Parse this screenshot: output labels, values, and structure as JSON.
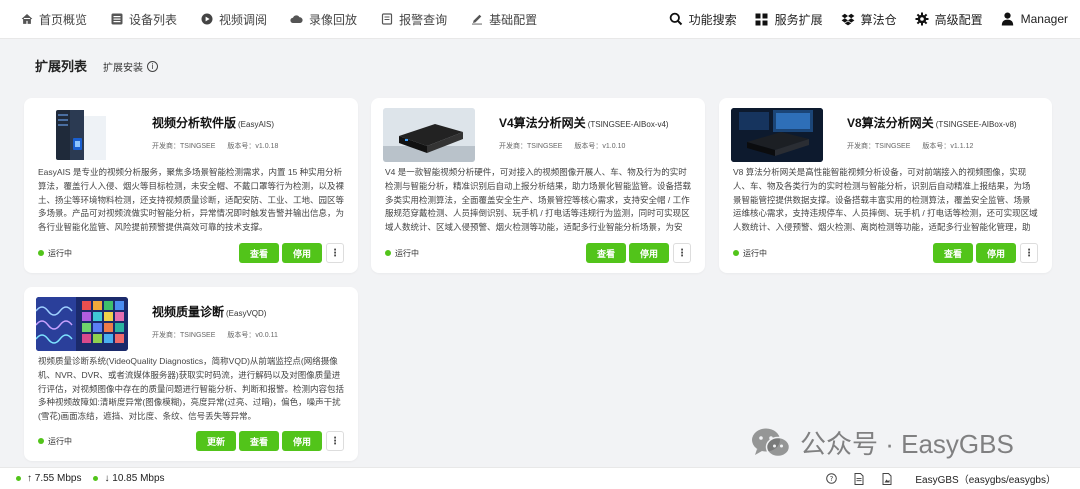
{
  "nav": {
    "left": [
      {
        "label": "首页概览",
        "icon": "home-icon"
      },
      {
        "label": "设备列表",
        "icon": "device-list-icon"
      },
      {
        "label": "视频调阅",
        "icon": "play-icon"
      },
      {
        "label": "录像回放",
        "icon": "cloud-icon"
      },
      {
        "label": "报警查询",
        "icon": "alarm-icon"
      },
      {
        "label": "基础配置",
        "icon": "pen-icon"
      }
    ],
    "right": [
      {
        "label": "功能搜索",
        "icon": "search-icon"
      },
      {
        "label": "服务扩展",
        "icon": "grid-icon"
      },
      {
        "label": "算法仓",
        "icon": "dropbox-icon"
      },
      {
        "label": "高级配置",
        "icon": "gear-icon"
      },
      {
        "label": "Manager",
        "icon": "user-icon"
      }
    ]
  },
  "page": {
    "title": "扩展列表",
    "install_label": "扩展安装",
    "info_glyph": "i"
  },
  "cards": [
    {
      "title": "视频分析软件版",
      "subtitle": "(EasyAIS)",
      "publisher": "开发商：TSINGSEE",
      "version": "版本号：v1.0.18",
      "description": "EasyAIS 是专业的视频分析服务，聚焦多场景智能检测需求，内置 15 种实用分析算法，覆盖行人入侵、烟火等目标检测，未安全帽、不戴口罩等行为检测，以及裸土、扬尘等环境物料检测，还支持视频质量诊断，适配安防、工业、工地、园区等多场景。产品可对视频流做实时智能分析，异常情况即时触发告警并输出信息，为各行业智能化监管、风险提前预警提供高效可靠的技术支撑。",
      "status": "运行中",
      "buttons": [
        "查看",
        "停用"
      ]
    },
    {
      "title": "V4算法分析网关",
      "subtitle": "(TSINGSEE-AIBox-v4)",
      "publisher": "开发商：TSINGSEE",
      "version": "版本号：v1.0.10",
      "description": "V4 是一款智能视频分析硬件，可对接入的视频图像开展人、车、物及行为的实时检测与智能分析，精准识别后自动上报分析结果，助力场景化智能监管。设备搭载多类实用检测算法，全面覆盖安全生产、场景管控等核心需求，支持安全帽 / 工作服规范穿戴检测、人员摔倒识别、玩手机 / 打电话等违规行为监测，同时可实现区域人数统计、区域入侵预警、烟火检测等功能，适配多行业智能分析场景，为安全…",
      "status": "运行中",
      "buttons": [
        "查看",
        "停用"
      ]
    },
    {
      "title": "V8算法分析网关",
      "subtitle": "(TSINGSEE-AIBox-v8)",
      "publisher": "开发商：TSINGSEE",
      "version": "版本号：v1.1.12",
      "description": "V8 算法分析网关是高性能智能视频分析设备，可对前端接入的视频图像，实现人、车、物及各类行为的实时检测与智能分析，识别后自动精准上报结果，为场景智能管控提供数据支撑。设备搭载丰富实用的检测算法，覆盖安全监管、场景运维核心需求，支持违规停车、人员摔倒、玩手机 / 打电话等检测，还可实现区域人数统计、入侵预警、烟火检测、离岗检测等功能，适配多行业智能化管理，助力安全…",
      "status": "运行中",
      "buttons": [
        "查看",
        "停用"
      ]
    },
    {
      "title": "视频质量诊断",
      "subtitle": "(EasyVQD)",
      "publisher": "开发商：TSINGSEE",
      "version": "版本号：v0.0.11",
      "description": "视频质量诊断系统(VideoQuality Diagnostics，简称VQD)从前端监控点(网络摄像机、NVR、DVR、或者流媒体服务器)获取实时码流，进行解码以及对图像质量进行评估，对视频图像中存在的质量问题进行智能分析、判断和报警。检测内容包括多种视频故障如:清晰度异常(图像模糊)，亮度异常(过亮、过暗)，偏色，噪声干扰(雪花)画面冻结，遮挡、对比度、条纹、信号丢失等异常。",
      "status": "运行中",
      "buttons": [
        "更新",
        "查看",
        "停用"
      ]
    }
  ],
  "more_glyph": "⋮",
  "footer": {
    "upload": "↑ 7.55 Mbps",
    "download": "↓ 10.85 Mbps",
    "brand": "EasyGBS（easygbs/easygbs）"
  },
  "watermark": {
    "text": "公众号 · EasyGBS"
  },
  "colors": {
    "accent_green": "#52c41a",
    "background": "#f2f3f5"
  }
}
